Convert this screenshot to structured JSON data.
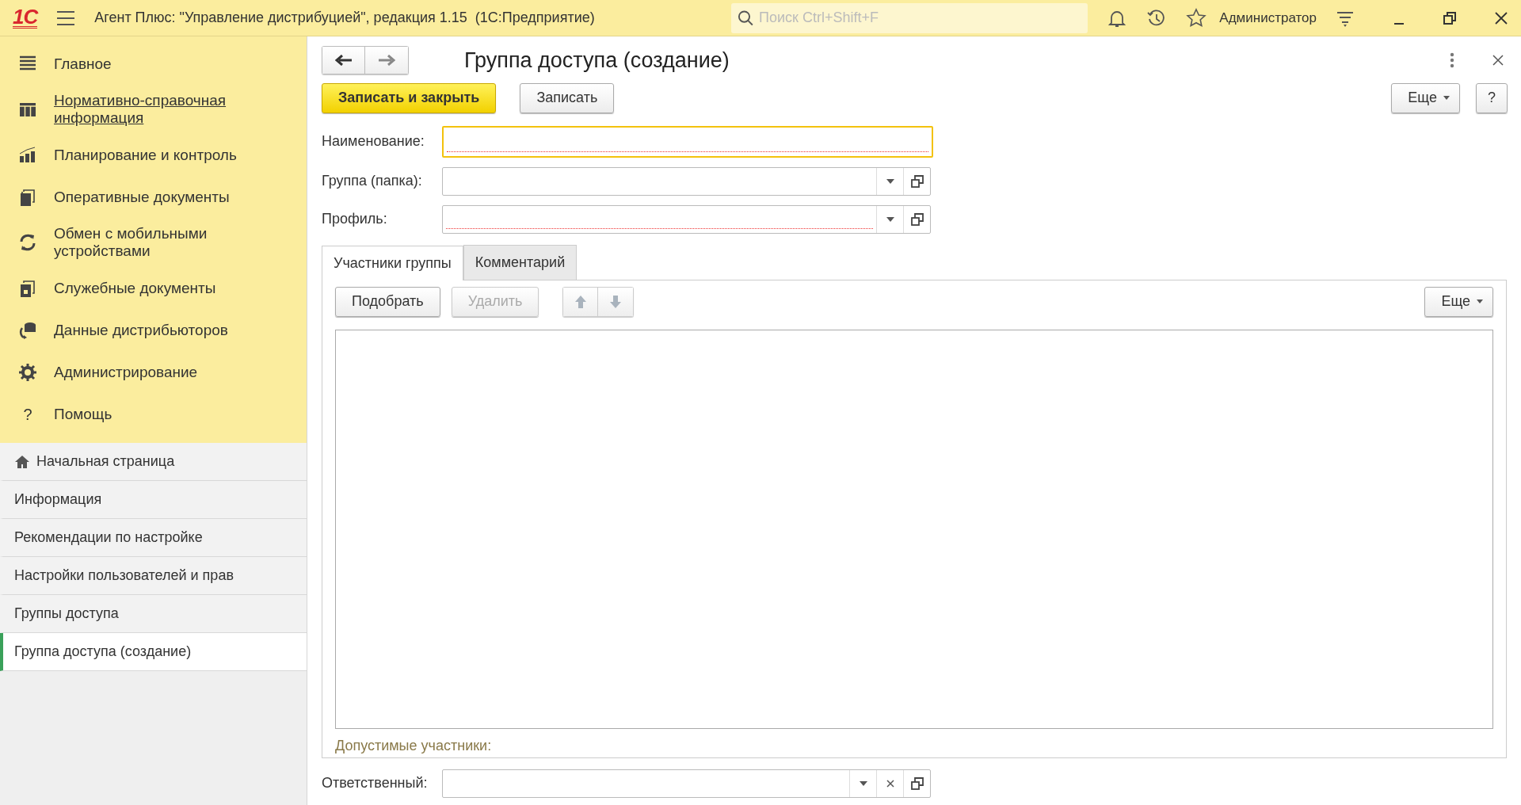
{
  "app": {
    "logo": "1С",
    "title": "Агент Плюс: \"Управление дистрибуцией\", редакция 1.15  (1С:Предприятие)",
    "search": {
      "placeholder": "Поиск Ctrl+Shift+F"
    },
    "user": "Администратор"
  },
  "sections": [
    {
      "label": "Главное",
      "hovered": false
    },
    {
      "label": "Нормативно-справочная информация",
      "hovered": true
    },
    {
      "label": "Планирование и контроль",
      "hovered": false
    },
    {
      "label": "Оперативные документы",
      "hovered": false
    },
    {
      "label": "Обмен с мобильными устройствами",
      "hovered": false
    },
    {
      "label": "Служебные документы",
      "hovered": false
    },
    {
      "label": "Данные дистрибьюторов",
      "hovered": false
    },
    {
      "label": "Администрирование",
      "hovered": false
    },
    {
      "label": "Помощь",
      "hovered": false,
      "glyph": "?"
    }
  ],
  "open_windows": [
    {
      "label": "Начальная страница",
      "kind": "home",
      "selected": false
    },
    {
      "label": "Информация",
      "kind": "page",
      "selected": false
    },
    {
      "label": "Рекомендации по настройке",
      "kind": "page",
      "selected": false
    },
    {
      "label": "Настройки пользователей и прав",
      "kind": "page",
      "selected": false
    },
    {
      "label": "Группы доступа",
      "kind": "page",
      "selected": false
    },
    {
      "label": "Группа доступа (создание)",
      "kind": "page",
      "selected": true
    }
  ],
  "form": {
    "title": "Группа доступа (создание)",
    "commands": [
      {
        "label": "Записать и закрыть",
        "kind": "primary"
      },
      {
        "label": "Записать",
        "kind": "normal"
      }
    ],
    "more": "Еще",
    "help": "?",
    "fields": [
      {
        "label": "Наименование:",
        "kind": "text",
        "focused": true,
        "required": true
      },
      {
        "label": "Группа (папка):",
        "kind": "choice",
        "focused": false,
        "required": false
      },
      {
        "label": "Профиль:",
        "kind": "choice",
        "focused": false,
        "required": true
      }
    ],
    "tabs": [
      {
        "label": "Участники группы",
        "selected": true
      },
      {
        "label": "Комментарий",
        "selected": false
      }
    ],
    "toolbar": [
      {
        "label": "Подобрать",
        "disabled": false
      },
      {
        "label": "Удалить",
        "disabled": true
      }
    ],
    "toolbar_more": "Еще",
    "allowed_label": "Допустимые участники:",
    "responsible": {
      "label": "Ответственный:",
      "kind": "choice_clear",
      "focused": false,
      "required": false
    }
  }
}
